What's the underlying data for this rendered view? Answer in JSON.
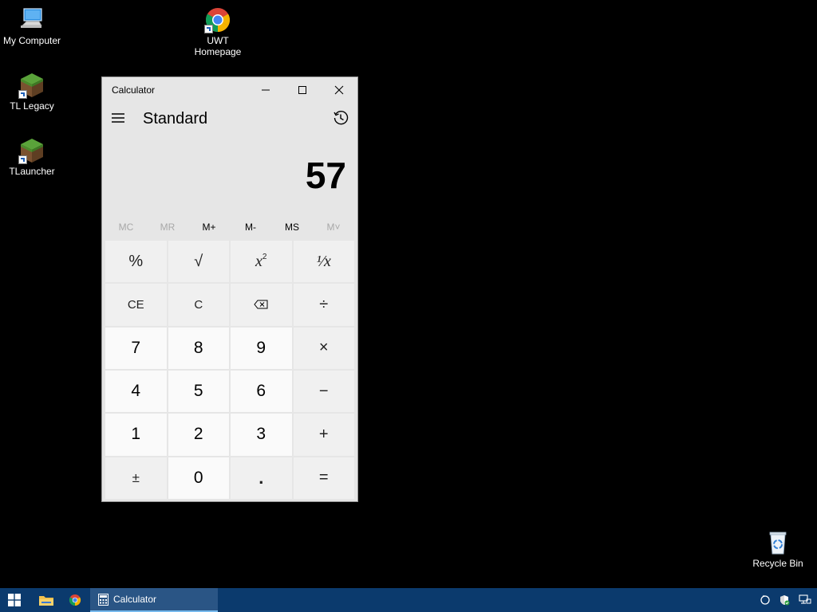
{
  "desktop": {
    "icons": [
      {
        "label": "My Computer",
        "icon": "computer-icon"
      },
      {
        "label": "UWT\nHomepage",
        "label_line1": "UWT",
        "label_line2": "Homepage",
        "icon": "chrome-icon"
      },
      {
        "label": "TL Legacy",
        "icon": "minecraft-block-icon"
      },
      {
        "label": "TLauncher",
        "icon": "minecraft-block-icon"
      },
      {
        "label": "Recycle Bin",
        "icon": "recycle-bin-icon"
      }
    ]
  },
  "calculator": {
    "window_title": "Calculator",
    "mode": "Standard",
    "display_value": "57",
    "memory_buttons": [
      {
        "label": "MC",
        "enabled": false
      },
      {
        "label": "MR",
        "enabled": false
      },
      {
        "label": "M+",
        "enabled": true
      },
      {
        "label": "M-",
        "enabled": true
      },
      {
        "label": "MS",
        "enabled": true
      },
      {
        "label": "M˅",
        "enabled": false
      }
    ],
    "keys": {
      "percent": "%",
      "sqrt": "√",
      "square_base": "x",
      "square_exp": "2",
      "reciprocal": "¹⁄x",
      "ce": "CE",
      "c": "C",
      "backspace": "⌫",
      "divide": "÷",
      "seven": "7",
      "eight": "8",
      "nine": "9",
      "multiply": "×",
      "four": "4",
      "five": "5",
      "six": "6",
      "minus": "−",
      "one": "1",
      "two": "2",
      "three": "3",
      "plus": "+",
      "negate": "±",
      "zero": "0",
      "decimal": ".",
      "equals": "="
    }
  },
  "taskbar": {
    "active_app_label": "Calculator",
    "accent": "#0b3a6d"
  }
}
